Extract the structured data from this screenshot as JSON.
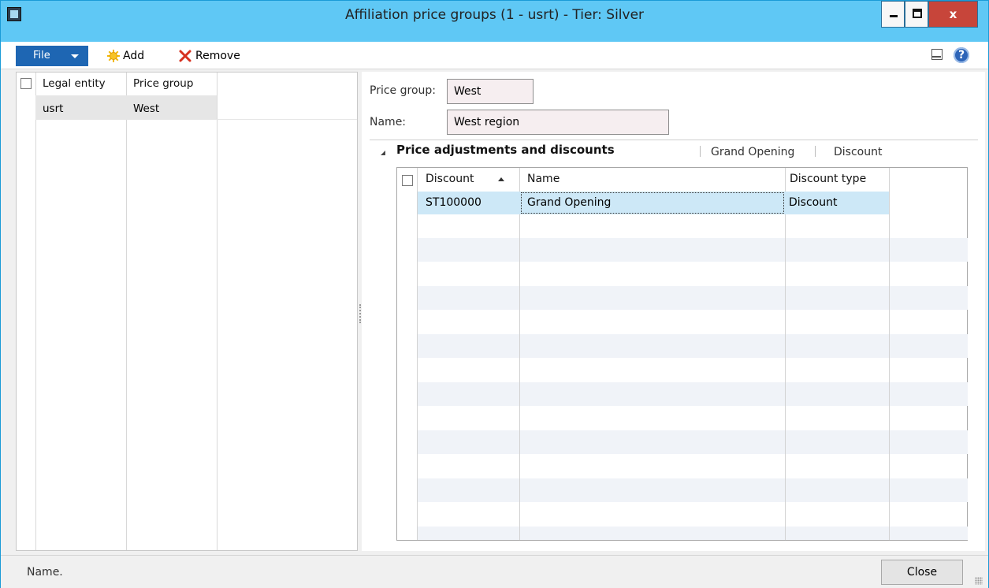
{
  "window": {
    "title": "Affiliation price groups (1 - usrt) - Tier: Silver",
    "close_glyph": "x"
  },
  "toolbar": {
    "file_label": "File",
    "add_label": "Add",
    "remove_label": "Remove",
    "help_glyph": "?"
  },
  "left_grid": {
    "columns": [
      "Legal entity",
      "Price group"
    ],
    "rows": [
      {
        "legal_entity": "usrt",
        "price_group": "West"
      }
    ]
  },
  "details": {
    "price_group_label": "Price group:",
    "price_group_value": "West",
    "name_label": "Name:",
    "name_value": "West region"
  },
  "section": {
    "title": "Price adjustments and discounts",
    "summary": [
      "Grand Opening",
      "Discount"
    ]
  },
  "discount_grid": {
    "columns": [
      "Discount",
      "Name",
      "Discount type"
    ],
    "sort_column": "Discount",
    "rows": [
      {
        "discount": "ST100000",
        "name": "Grand Opening",
        "discount_type": "Discount"
      }
    ]
  },
  "status": {
    "text": "Name.",
    "close_label": "Close"
  },
  "colors": {
    "title_bar": "#5fc8f5",
    "file_button": "#1e66b3",
    "selected_row": "#cde8f7",
    "close_button": "#c7453a"
  }
}
